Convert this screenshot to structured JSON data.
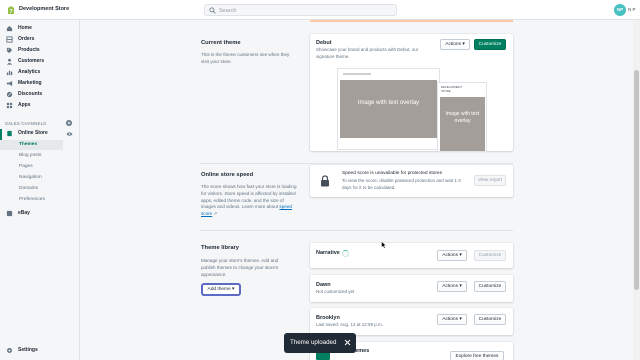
{
  "topbar": {
    "store_name": "Development Store",
    "search_placeholder": "Search",
    "user_avatar_initials": "NP",
    "user_name_short": "N P"
  },
  "sidebar": {
    "items": [
      {
        "label": "Home",
        "icon": "home-icon"
      },
      {
        "label": "Orders",
        "icon": "orders-icon"
      },
      {
        "label": "Products",
        "icon": "tag-icon"
      },
      {
        "label": "Customers",
        "icon": "person-icon"
      },
      {
        "label": "Analytics",
        "icon": "bar-chart-icon"
      },
      {
        "label": "Marketing",
        "icon": "megaphone-icon"
      },
      {
        "label": "Discounts",
        "icon": "discount-icon"
      },
      {
        "label": "Apps",
        "icon": "apps-icon"
      }
    ],
    "sales_channels_header": "SALES CHANNELS",
    "online_store": "Online Store",
    "sub_items": [
      "Themes",
      "Blog posts",
      "Pages",
      "Navigation",
      "Domains",
      "Preferences"
    ],
    "active_sub_item": "Themes",
    "ebay": "eBay",
    "settings": "Settings"
  },
  "current_theme": {
    "section_title": "Current theme",
    "section_desc": "This is the theme customers see when they visit your store.",
    "theme_name": "Debut",
    "theme_desc": "Showcase your brand and products with Debut, our signature theme.",
    "actions_label": "Actions",
    "customize_label": "Customize",
    "preview_desktop_title": "Image with text overlay",
    "preview_mobile_header": "DEVELOPMENT STORE",
    "preview_mobile_title": "Image with text overlay"
  },
  "speed": {
    "section_title": "Online store speed",
    "section_desc": "The score shows how fast your store is loading for visitors. Store speed is affected by installed apps, edited theme code, and the size of images and videos. Learn more about",
    "link_text": "speed score",
    "card_title": "Speed score is unavailable for protected stores",
    "card_desc": "To view the score, disable password protection and wait 1-3 days for it to be calculated.",
    "view_report_label": "View report"
  },
  "library": {
    "section_title": "Theme library",
    "section_desc": "Manage your store's themes. Add and publish themes to change your store's appearance.",
    "add_theme_label": "Add theme",
    "themes": [
      {
        "name": "Narrative",
        "status": "",
        "loading": true,
        "customize_enabled": false
      },
      {
        "name": "Dawn",
        "status": "Not customized yet",
        "loading": false,
        "customize_enabled": true
      },
      {
        "name": "Brooklyn",
        "status": "Last saved: Aug. 12 at 12:59 p.m.",
        "loading": false,
        "customize_enabled": true
      }
    ],
    "partial_card_title": "themes",
    "explore_label": "Explore free themes",
    "actions_label": "Actions",
    "customize_label": "Customize"
  },
  "toast": {
    "message": "Theme uploaded"
  },
  "colors": {
    "primary": "#008060",
    "link": "#006fbb",
    "sidebar_bg": "#f4f6f8",
    "toast_bg": "#212b36"
  }
}
